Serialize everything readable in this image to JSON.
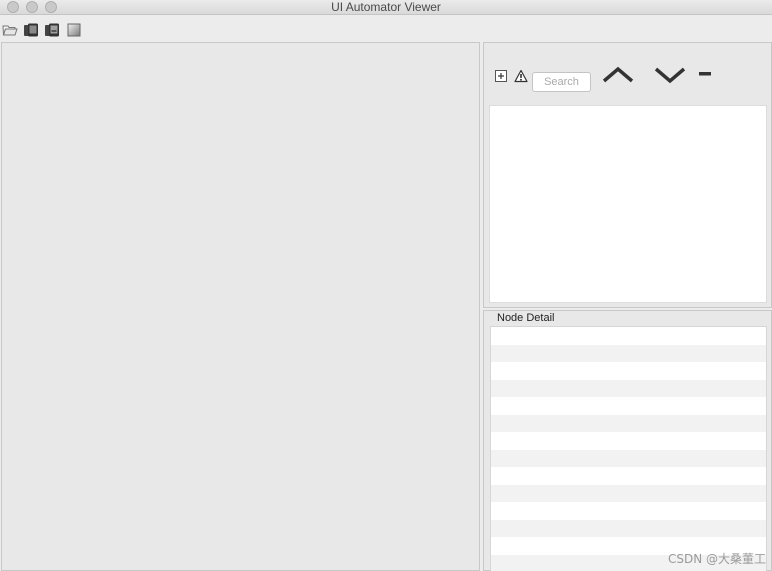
{
  "window": {
    "title": "UI Automator Viewer"
  },
  "toolbar": {
    "icons": [
      "open-folder-icon",
      "device-screenshot-icon",
      "device-screenshot-compressed-icon",
      "save-icon"
    ]
  },
  "hierarchy": {
    "search_placeholder": "Search",
    "icons": [
      "expand-all-icon",
      "warning-icon",
      "chevron-up-icon",
      "chevron-down-icon",
      "minus-icon"
    ]
  },
  "node_detail": {
    "label": "Node Detail",
    "rows": 14
  },
  "watermark": "CSDN @大桑董工"
}
